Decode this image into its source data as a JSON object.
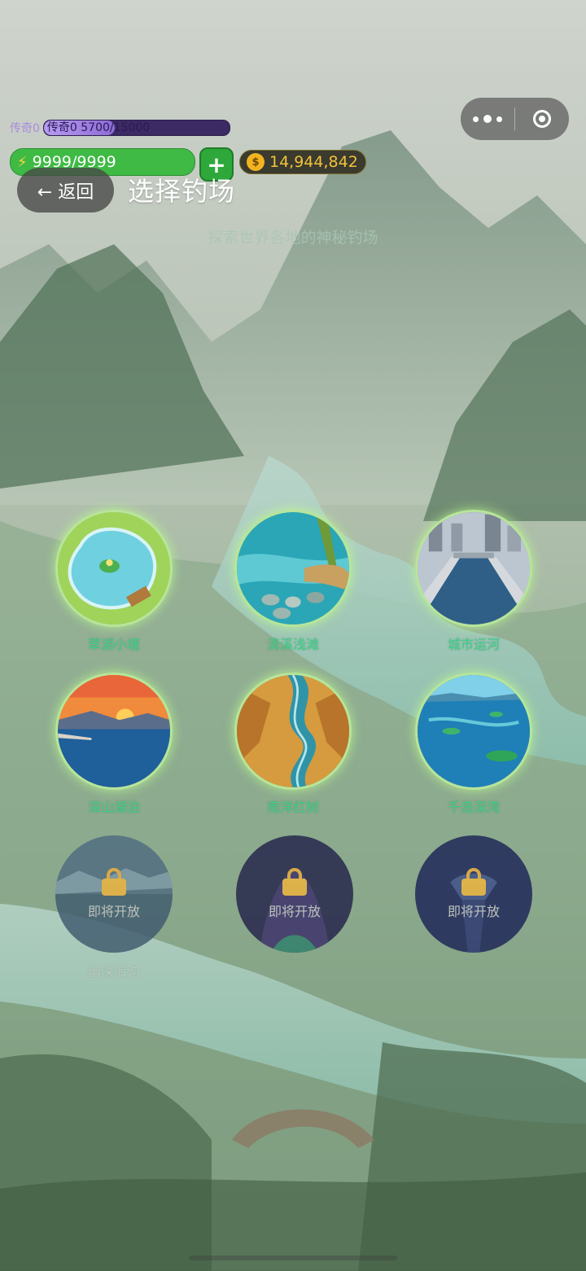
{
  "legend": {
    "tag": "传奇0",
    "bar_text": "传奇0  5700/15000",
    "progress": 0.38
  },
  "energy": {
    "icon": "lightning-icon",
    "value": "9999/9999"
  },
  "add_button": {
    "label": "+"
  },
  "coins": {
    "icon": "money-bag-icon",
    "value": "14,944,842"
  },
  "capsule": {
    "more_icon": "more-dots-icon",
    "close_icon": "target-close-icon"
  },
  "header": {
    "back_label": "← 返回",
    "title": "选择钓场",
    "subtitle": "探索世界各地的神秘钓场"
  },
  "spots": [
    {
      "name": "翠湖小塘",
      "locked": false
    },
    {
      "name": "清溪浅滩",
      "locked": false
    },
    {
      "name": "城市运河",
      "locked": false
    },
    {
      "name": "深山湖泊",
      "locked": false
    },
    {
      "name": "南洋红树",
      "locked": false
    },
    {
      "name": "千岛深湾",
      "locked": false
    },
    {
      "name": "幽深海沟",
      "locked": true,
      "badge": "即将开放"
    },
    {
      "name": "",
      "locked": true,
      "badge": "即将开放"
    },
    {
      "name": "",
      "locked": true,
      "badge": "即将开放"
    }
  ],
  "colors": {
    "accent_green": "#3ed18a",
    "energy_green": "#3fba45",
    "coin_gold": "#f2c23a",
    "xp_purple": "#8e6ad6"
  }
}
